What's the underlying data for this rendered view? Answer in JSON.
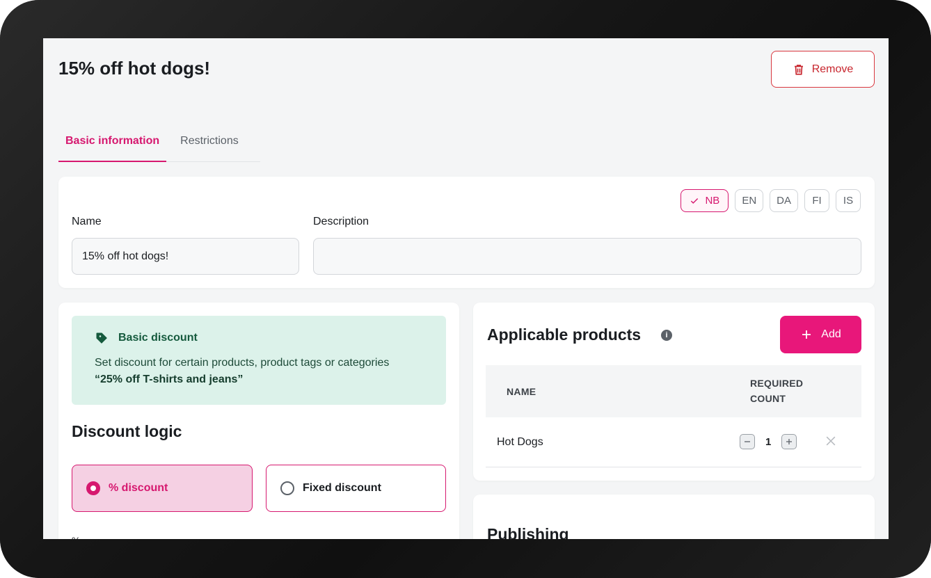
{
  "page": {
    "title": "15% off hot dogs!",
    "remove_label": "Remove"
  },
  "tabs": [
    {
      "label": "Basic information",
      "active": true
    },
    {
      "label": "Restrictions",
      "active": false
    }
  ],
  "languages": [
    {
      "code": "NB",
      "active": true
    },
    {
      "code": "EN",
      "active": false
    },
    {
      "code": "DA",
      "active": false
    },
    {
      "code": "FI",
      "active": false
    },
    {
      "code": "IS",
      "active": false
    }
  ],
  "form": {
    "name_label": "Name",
    "name_value": "15% off hot dogs!",
    "description_label": "Description",
    "description_value": ""
  },
  "discount_info": {
    "title": "Basic discount",
    "text": "Set discount for certain products, product tags or categories",
    "example": "“25% off T-shirts and jeans”"
  },
  "discount_logic": {
    "title": "Discount logic",
    "options": [
      {
        "label": "% discount",
        "selected": true
      },
      {
        "label": "Fixed discount",
        "selected": false
      }
    ],
    "field_label": "%"
  },
  "products": {
    "title": "Applicable products",
    "info_icon": "i",
    "add_label": "Add",
    "columns": {
      "name": "NAME",
      "required_line1": "REQUIRED",
      "required_line2": "COUNT"
    },
    "rows": [
      {
        "name": "Hot Dogs",
        "count": "1"
      }
    ]
  },
  "publishing": {
    "title": "Publishing"
  },
  "colors": {
    "accent": "#d6186f",
    "add_button": "#e8177a",
    "danger": "#c8262e",
    "info_bg": "#dcf2ea"
  }
}
